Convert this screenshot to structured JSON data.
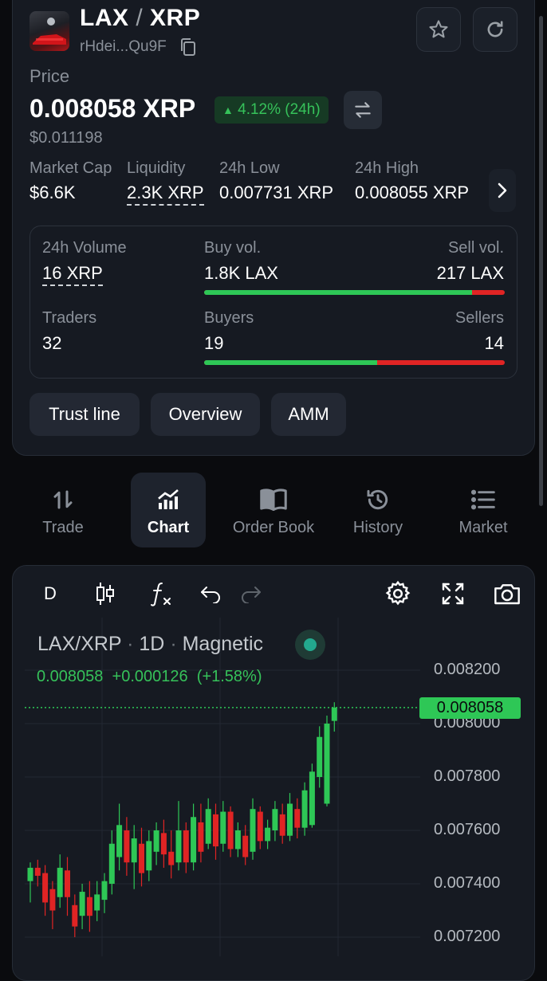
{
  "header": {
    "base": "LAX",
    "sep": "/",
    "quote": "XRP",
    "address": "rHdei...Qu9F"
  },
  "price": {
    "label": "Price",
    "value": "0.008058 XRP",
    "change": "4.12% (24h)",
    "usd": "$0.011198"
  },
  "stats": {
    "market_cap_label": "Market Cap",
    "market_cap": "$6.6K",
    "liquidity_label": "Liquidity",
    "liquidity": "2.3K XRP",
    "low_label": "24h Low",
    "low": "0.007731 XRP",
    "high_label": "24h High",
    "high": "0.008055 XRP"
  },
  "volume": {
    "vol_label": "24h Volume",
    "vol": "16 XRP",
    "buy_label": "Buy vol.",
    "buy": "1.8K LAX",
    "sell_label": "Sell vol.",
    "sell": "217 LAX",
    "buy_fraction": 0.892,
    "traders_label": "Traders",
    "traders": "32",
    "buyers_label": "Buyers",
    "buyers": "19",
    "sellers_label": "Sellers",
    "sellers": "14",
    "buyers_fraction": 0.576
  },
  "pills": [
    "Trust line",
    "Overview",
    "AMM"
  ],
  "tabs": [
    {
      "label": "Trade",
      "icon": "arrows-updown-icon",
      "active": false
    },
    {
      "label": "Chart",
      "icon": "chart-icon",
      "active": true
    },
    {
      "label": "Order Book",
      "icon": "book-icon",
      "active": false
    },
    {
      "label": "History",
      "icon": "history-icon",
      "active": false
    },
    {
      "label": "Market",
      "icon": "list-icon",
      "active": false
    }
  ],
  "chart_toolbar": {
    "interval": "D"
  },
  "chart_legend": {
    "symbol": "LAX/XRP",
    "sep": "·",
    "tf": "1D",
    "mode": "Magnetic",
    "close": "0.008058",
    "change": "+0.000126",
    "change_pct": "(+1.58%)"
  },
  "colors": {
    "up": "#2ec756",
    "down": "#e02424",
    "accent": "#36c25a"
  },
  "chart_data": {
    "type": "candlestick",
    "y_ticks": [
      "0.008200",
      "0.008000",
      "0.007800",
      "0.007600",
      "0.007400",
      "0.007200"
    ],
    "last_price_label": "0.008058",
    "ylim": [
      0.0072,
      0.00822
    ],
    "grid": true,
    "candles": [
      [
        0.00741,
        0.00746,
        0.00733,
        0.00748
      ],
      [
        0.00746,
        0.00743,
        0.00739,
        0.00749
      ],
      [
        0.00744,
        0.00733,
        0.00728,
        0.00747
      ],
      [
        0.00738,
        0.0073,
        0.00723,
        0.00741
      ],
      [
        0.00735,
        0.00746,
        0.00731,
        0.00751
      ],
      [
        0.00745,
        0.00735,
        0.00728,
        0.0075
      ],
      [
        0.00732,
        0.00724,
        0.0072,
        0.00736
      ],
      [
        0.00728,
        0.00737,
        0.00723,
        0.0074
      ],
      [
        0.00735,
        0.00728,
        0.00722,
        0.00741
      ],
      [
        0.0073,
        0.00736,
        0.00726,
        0.00741
      ],
      [
        0.00734,
        0.00741,
        0.00729,
        0.00744
      ],
      [
        0.0074,
        0.00755,
        0.00736,
        0.0076
      ],
      [
        0.0075,
        0.00762,
        0.00745,
        0.0077
      ],
      [
        0.0076,
        0.00748,
        0.00743,
        0.00765
      ],
      [
        0.00748,
        0.00757,
        0.00738,
        0.00762
      ],
      [
        0.00755,
        0.00744,
        0.00739,
        0.00761
      ],
      [
        0.00745,
        0.00756,
        0.00741,
        0.0076
      ],
      [
        0.00752,
        0.0076,
        0.00747,
        0.00763
      ],
      [
        0.00759,
        0.00751,
        0.00746,
        0.00764
      ],
      [
        0.00752,
        0.00747,
        0.00742,
        0.0076
      ],
      [
        0.00748,
        0.0076,
        0.00745,
        0.00771
      ],
      [
        0.0076,
        0.00748,
        0.00744,
        0.00763
      ],
      [
        0.00748,
        0.00765,
        0.00745,
        0.0077
      ],
      [
        0.00763,
        0.00752,
        0.00748,
        0.0077
      ],
      [
        0.00755,
        0.00768,
        0.00753,
        0.00772
      ],
      [
        0.00766,
        0.00754,
        0.00749,
        0.0077
      ],
      [
        0.00755,
        0.00767,
        0.00752,
        0.00771
      ],
      [
        0.00767,
        0.00753,
        0.0075,
        0.00769
      ],
      [
        0.00753,
        0.0076,
        0.0075,
        0.00763
      ],
      [
        0.00758,
        0.0075,
        0.00747,
        0.00762
      ],
      [
        0.00752,
        0.00768,
        0.00749,
        0.00772
      ],
      [
        0.00767,
        0.00756,
        0.00753,
        0.00769
      ],
      [
        0.00756,
        0.00761,
        0.00753,
        0.00764
      ],
      [
        0.0076,
        0.00768,
        0.00756,
        0.00771
      ],
      [
        0.00766,
        0.00758,
        0.00755,
        0.0077
      ],
      [
        0.00758,
        0.0077,
        0.00756,
        0.00774
      ],
      [
        0.00768,
        0.00761,
        0.00757,
        0.00772
      ],
      [
        0.00761,
        0.00775,
        0.00758,
        0.00778
      ],
      [
        0.00762,
        0.00782,
        0.00761,
        0.00785
      ],
      [
        0.0078,
        0.00795,
        0.00776,
        0.00799
      ],
      [
        0.0077,
        0.008,
        0.00769,
        0.00803
      ],
      [
        0.00801,
        0.00806,
        0.00797,
        0.00808
      ]
    ]
  }
}
